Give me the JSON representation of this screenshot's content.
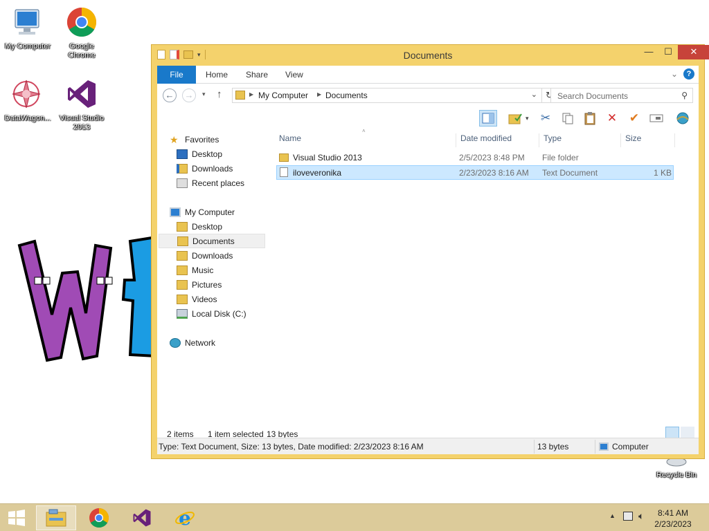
{
  "desktop": {
    "icons": [
      {
        "label": "My Computer",
        "icon": "computer-icon"
      },
      {
        "label": "Google Chrome",
        "icon": "chrome-icon"
      },
      {
        "label": "DataWagon...",
        "icon": "datawagon-icon"
      },
      {
        "label": "Visual Studio 2013",
        "icon": "visual-studio-icon"
      },
      {
        "label": "Recycle Bin",
        "icon": "recycle-bin-icon"
      }
    ]
  },
  "window": {
    "title": "Documents",
    "controls": {
      "minimize": "—",
      "maximize": "☐",
      "close": "✕"
    }
  },
  "ribbon": {
    "tabs": [
      "File",
      "Home",
      "Share",
      "View"
    ],
    "help": "?"
  },
  "addressbar": {
    "crumbs": [
      "My Computer",
      "Documents"
    ],
    "search_placeholder": "Search Documents"
  },
  "navpane": {
    "favorites": {
      "label": "Favorites",
      "items": [
        "Desktop",
        "Downloads",
        "Recent places"
      ]
    },
    "computer": {
      "label": "My Computer",
      "items": [
        "Desktop",
        "Documents",
        "Downloads",
        "Music",
        "Pictures",
        "Videos",
        "Local Disk (C:)"
      ]
    },
    "network": {
      "label": "Network"
    },
    "selected": "Documents"
  },
  "files": {
    "columns": [
      "Name",
      "Date modified",
      "Type",
      "Size"
    ],
    "rows": [
      {
        "name": "Visual Studio 2013",
        "date": "2/5/2023 8:48 PM",
        "type": "File folder",
        "size": ""
      },
      {
        "name": "iloveveronika",
        "date": "2/23/2023 8:16 AM",
        "type": "Text Document",
        "size": "1 KB"
      }
    ]
  },
  "status": {
    "items": "2 items",
    "selected": "1 item selected",
    "bytes": "13 bytes"
  },
  "details": {
    "info": "Type: Text Document, Size: 13 bytes, Date modified: 2/23/2023 8:16 AM",
    "size": "13 bytes",
    "location": "Computer"
  },
  "taskbar": {
    "time": "8:41 AM",
    "date": "2/23/2023"
  },
  "colors": {
    "window_frame": "#f4d26c",
    "file_tab": "#1979ca",
    "close_button": "#c7433a",
    "selection": "#cce8ff",
    "taskbar": "#dccb9a"
  }
}
